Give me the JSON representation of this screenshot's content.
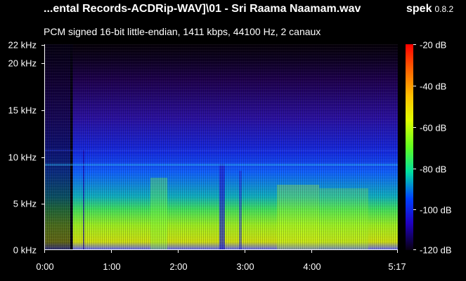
{
  "header": {
    "file_title": "...ental Records-ACDRip-WAV]\\01 - Sri Raama Naamam.wav",
    "app_name": "spek",
    "app_version": "0.8.2",
    "stream_info": "PCM signed 16-bit little-endian, 1411 kbps, 44100 Hz, 2 canaux"
  },
  "spectrogram": {
    "frequency_axis": {
      "labels": [
        "22 kHz",
        "20 kHz",
        "15 kHz",
        "10 kHz",
        "5 kHz",
        "0 kHz"
      ]
    },
    "time_axis": {
      "labels": [
        "0:00",
        "1:00",
        "2:00",
        "3:00",
        "4:00",
        "5:17"
      ]
    },
    "colorbar": {
      "labels": [
        "-20 dB",
        "-40 dB",
        "-60 dB",
        "-80 dB",
        "-100 dB",
        "-120 dB"
      ]
    }
  }
}
